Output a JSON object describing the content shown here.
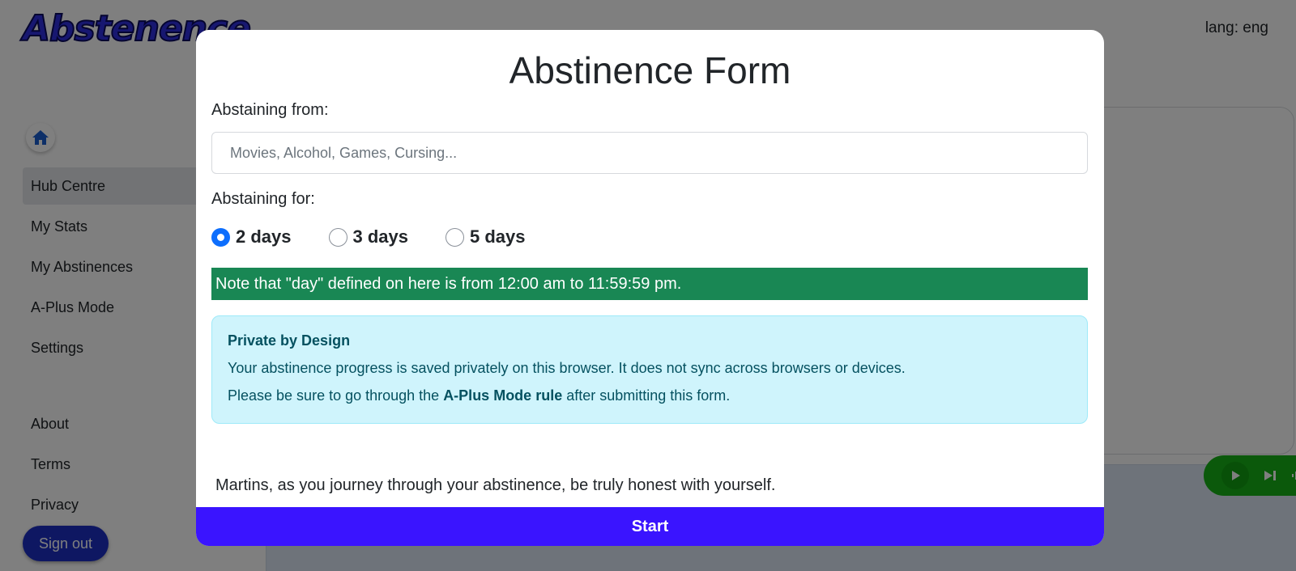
{
  "app": {
    "logo": "Abstenence",
    "lang_label": "lang: eng"
  },
  "sidebar": {
    "items": [
      {
        "label": "Hub Centre",
        "active": true
      },
      {
        "label": "My Stats"
      },
      {
        "label": "My Abstinences"
      },
      {
        "label": "A-Plus Mode"
      },
      {
        "label": "Settings"
      }
    ],
    "footer_items": [
      {
        "label": "About"
      },
      {
        "label": "Terms"
      },
      {
        "label": "Privacy"
      }
    ],
    "sign_out_label": "Sign out"
  },
  "modal": {
    "title": "Abstinence Form",
    "abstaining_from_label": "Abstaining from:",
    "abstaining_from_placeholder": "Movies, Alcohol, Games, Cursing...",
    "abstaining_from_value": "",
    "abstaining_for_label": "Abstaining for:",
    "duration_options": [
      {
        "label": "2 days",
        "checked": true
      },
      {
        "label": "3 days",
        "checked": false
      },
      {
        "label": "5 days",
        "checked": false
      }
    ],
    "day_note": "Note that \"day\" defined on here is from 12:00 am to 11:59:59 pm.",
    "info": {
      "title": "Private by Design",
      "line1": "Your abstinence progress is saved privately on this browser. It does not sync across browsers or devices.",
      "line2_prefix": "Please be sure to go through the ",
      "line2_bold": "A-Plus Mode rule",
      "line2_suffix": " after submitting this form."
    },
    "honesty_message": "Martins, as you journey through your abstinence, be truly honest with yourself.",
    "start_label": "Start"
  },
  "colors": {
    "primary_radio": "#0d6efd",
    "note_bar": "#198754",
    "info_bg": "#cff4fc",
    "info_text": "#055160",
    "start_button": "#3a14ff",
    "sign_out_button": "#1c2fc4",
    "player": "#16b316"
  },
  "icons": {
    "home": "home-icon",
    "play": "play-icon",
    "skip_next": "skip-next-icon",
    "audio_wave": "audio-wave-icon"
  }
}
